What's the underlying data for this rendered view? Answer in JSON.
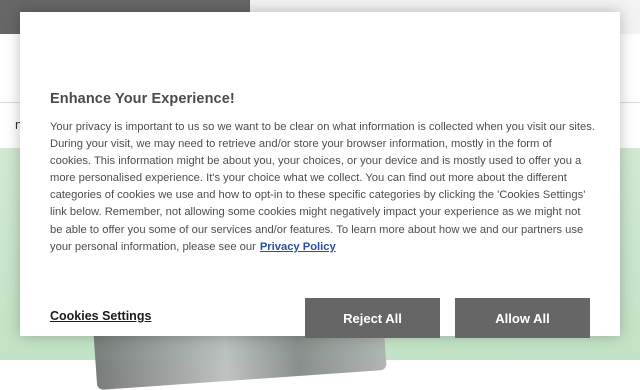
{
  "background": {
    "nav_text": "n"
  },
  "banner": {
    "title": "Enhance Your Experience!",
    "body": "Your privacy is important to us so we want to be clear on what information is collected when you visit our sites. During your visit, we may need to retrieve and/or store your browser information, mostly in the form of cookies. This information might be about you, your choices, or your device and is mostly used to offer you a more personalised experience. It's your choice what we collect. You can find out more about the different categories of cookies we use and how to opt-in to these specific categories by clicking the 'Cookies Settings' link below. Remember, not allowing some cookies might negatively impact your experience as we might not be able to offer you some of our services and/or features. To learn more about how we and our partners use your personal information, please see our",
    "privacy_link": "Privacy Policy",
    "settings_label": "Cookies Settings",
    "reject_label": "Reject All",
    "allow_label": "Allow All"
  },
  "colors": {
    "button_bg": "#666666",
    "link": "#2b4ea2",
    "hero_bg": "#cfe8d0"
  }
}
